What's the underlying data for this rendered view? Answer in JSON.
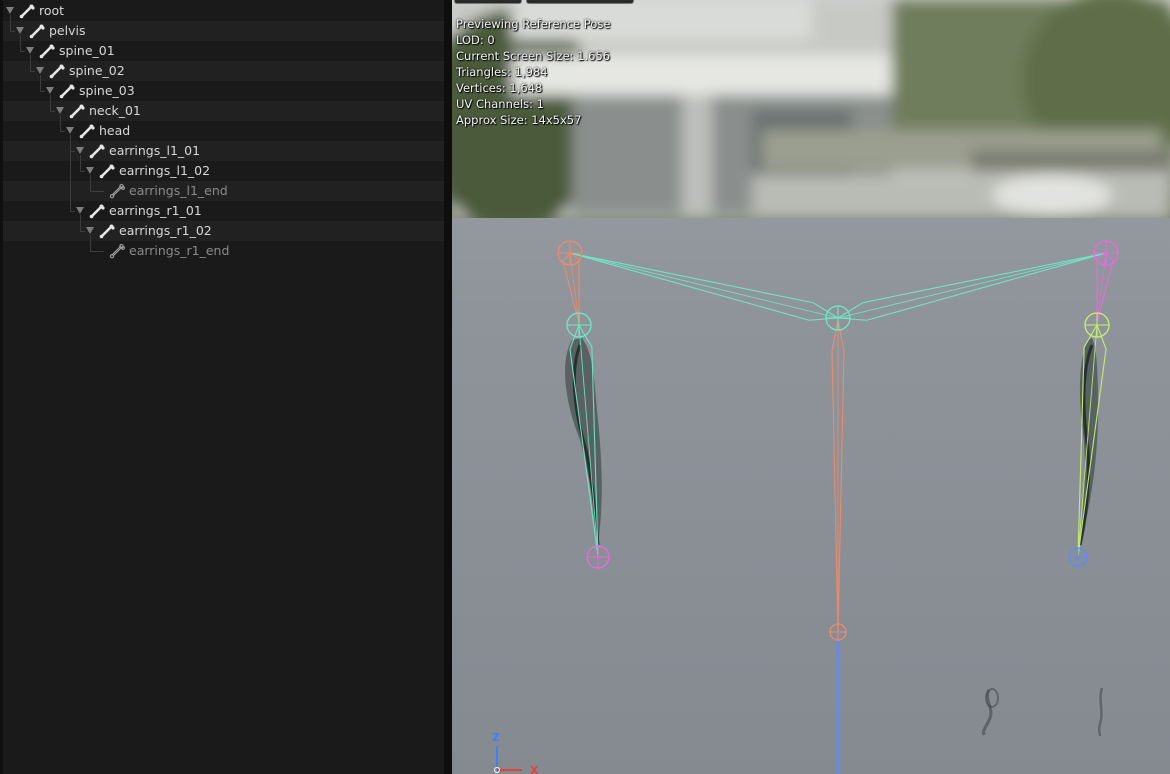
{
  "skeleton_tree": {
    "rows": [
      {
        "label": "root",
        "depth": 0,
        "leaf": false
      },
      {
        "label": "pelvis",
        "depth": 1,
        "leaf": false
      },
      {
        "label": "spine_01",
        "depth": 2,
        "leaf": false
      },
      {
        "label": "spine_02",
        "depth": 3,
        "leaf": false
      },
      {
        "label": "spine_03",
        "depth": 4,
        "leaf": false
      },
      {
        "label": "neck_01",
        "depth": 5,
        "leaf": false
      },
      {
        "label": "head",
        "depth": 6,
        "leaf": false
      },
      {
        "label": "earrings_l1_01",
        "depth": 7,
        "leaf": false
      },
      {
        "label": "earrings_l1_02",
        "depth": 8,
        "leaf": false
      },
      {
        "label": "earrings_l1_end",
        "depth": 9,
        "leaf": true
      },
      {
        "label": "earrings_r1_01",
        "depth": 7,
        "leaf": false
      },
      {
        "label": "earrings_r1_02",
        "depth": 8,
        "leaf": false
      },
      {
        "label": "earrings_r1_end",
        "depth": 9,
        "leaf": true
      }
    ]
  },
  "viewport": {
    "stats": [
      "Previewing Reference Pose",
      "LOD: 0",
      "Current Screen Size: 1.656",
      "Triangles: 1,984",
      "Vertices: 1,648",
      "UV Channels: 1",
      "Approx Size: 14x5x57"
    ],
    "axis_gizmo": {
      "z_label": "Z",
      "x_label": "X",
      "z_color": "#3f7fff",
      "x_color": "#e8403a"
    },
    "colors": {
      "chain_root": "#f08a6a",
      "chain_cyan": "#6fe8c4",
      "chain_pink": "#e86ae0",
      "chain_lime": "#c8f070",
      "chain_blue": "#5a8cff"
    }
  }
}
